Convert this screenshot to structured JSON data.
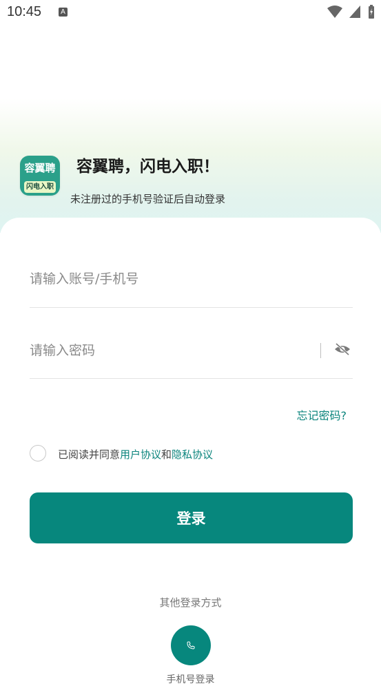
{
  "status_bar": {
    "time": "10:45",
    "notification_icon": "A"
  },
  "brand": {
    "logo_top": "容翼聘",
    "logo_bottom": "闪电入职",
    "title": "容翼聘，闪电入职！",
    "subtitle": "未注册过的手机号验证后自动登录"
  },
  "form": {
    "account_placeholder": "请输入账号/手机号",
    "password_placeholder": "请输入密码",
    "forgot": "忘记密码?",
    "agree_prefix": "已阅读并同意",
    "user_agreement": "用户协议",
    "and": "和",
    "privacy_agreement": "隐私协议",
    "login": "登录"
  },
  "other_login": {
    "heading": "其他登录方式",
    "phone_label": "手机号登录"
  },
  "colors": {
    "accent": "#07877d",
    "link": "#0b847c"
  },
  "icons": [
    "wifi-icon",
    "signal-icon",
    "battery-icon",
    "eye-off-icon",
    "phone-icon"
  ]
}
